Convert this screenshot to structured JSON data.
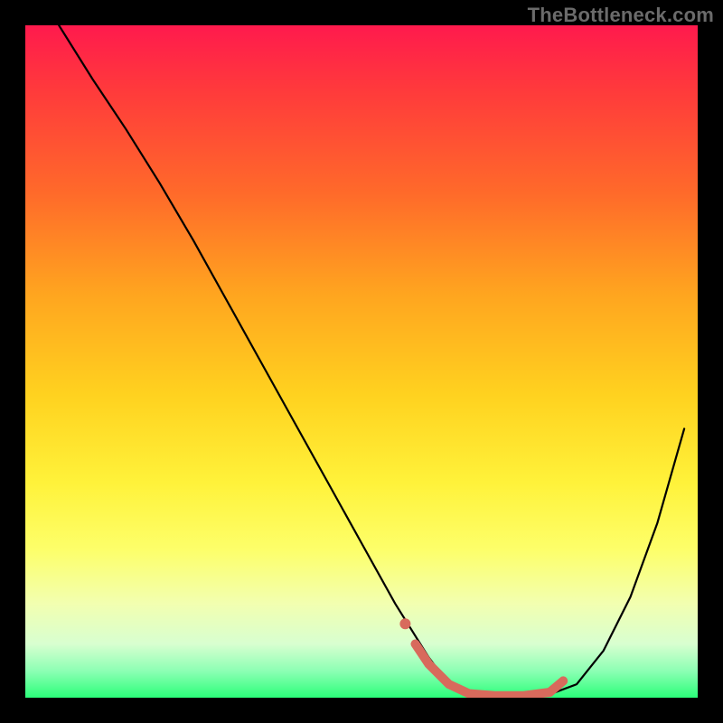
{
  "watermark": "TheBottleneck.com",
  "chart_data": {
    "type": "line",
    "title": "",
    "xlabel": "",
    "ylabel": "",
    "xlim": [
      0,
      100
    ],
    "ylim": [
      0,
      100
    ],
    "grid": false,
    "legend": false,
    "background": "rainbow-gradient (red→yellow→green, top→bottom)",
    "series": [
      {
        "name": "curve",
        "color": "#000000",
        "x": [
          5,
          10,
          15,
          20,
          25,
          30,
          35,
          40,
          45,
          50,
          55,
          60,
          63,
          66,
          70,
          74,
          78,
          82,
          86,
          90,
          94,
          98
        ],
        "y": [
          100,
          92,
          84.5,
          76.5,
          68,
          59,
          50,
          41,
          32,
          23,
          14,
          6,
          2,
          0.5,
          0.2,
          0.2,
          0.5,
          2,
          7,
          15,
          26,
          40
        ]
      },
      {
        "name": "highlight",
        "color": "#d86a5c",
        "x": [
          58,
          60,
          63,
          66,
          70,
          74,
          78,
          80
        ],
        "y": [
          8,
          5,
          2,
          0.6,
          0.3,
          0.3,
          0.8,
          2.5
        ]
      }
    ],
    "annotations": []
  }
}
